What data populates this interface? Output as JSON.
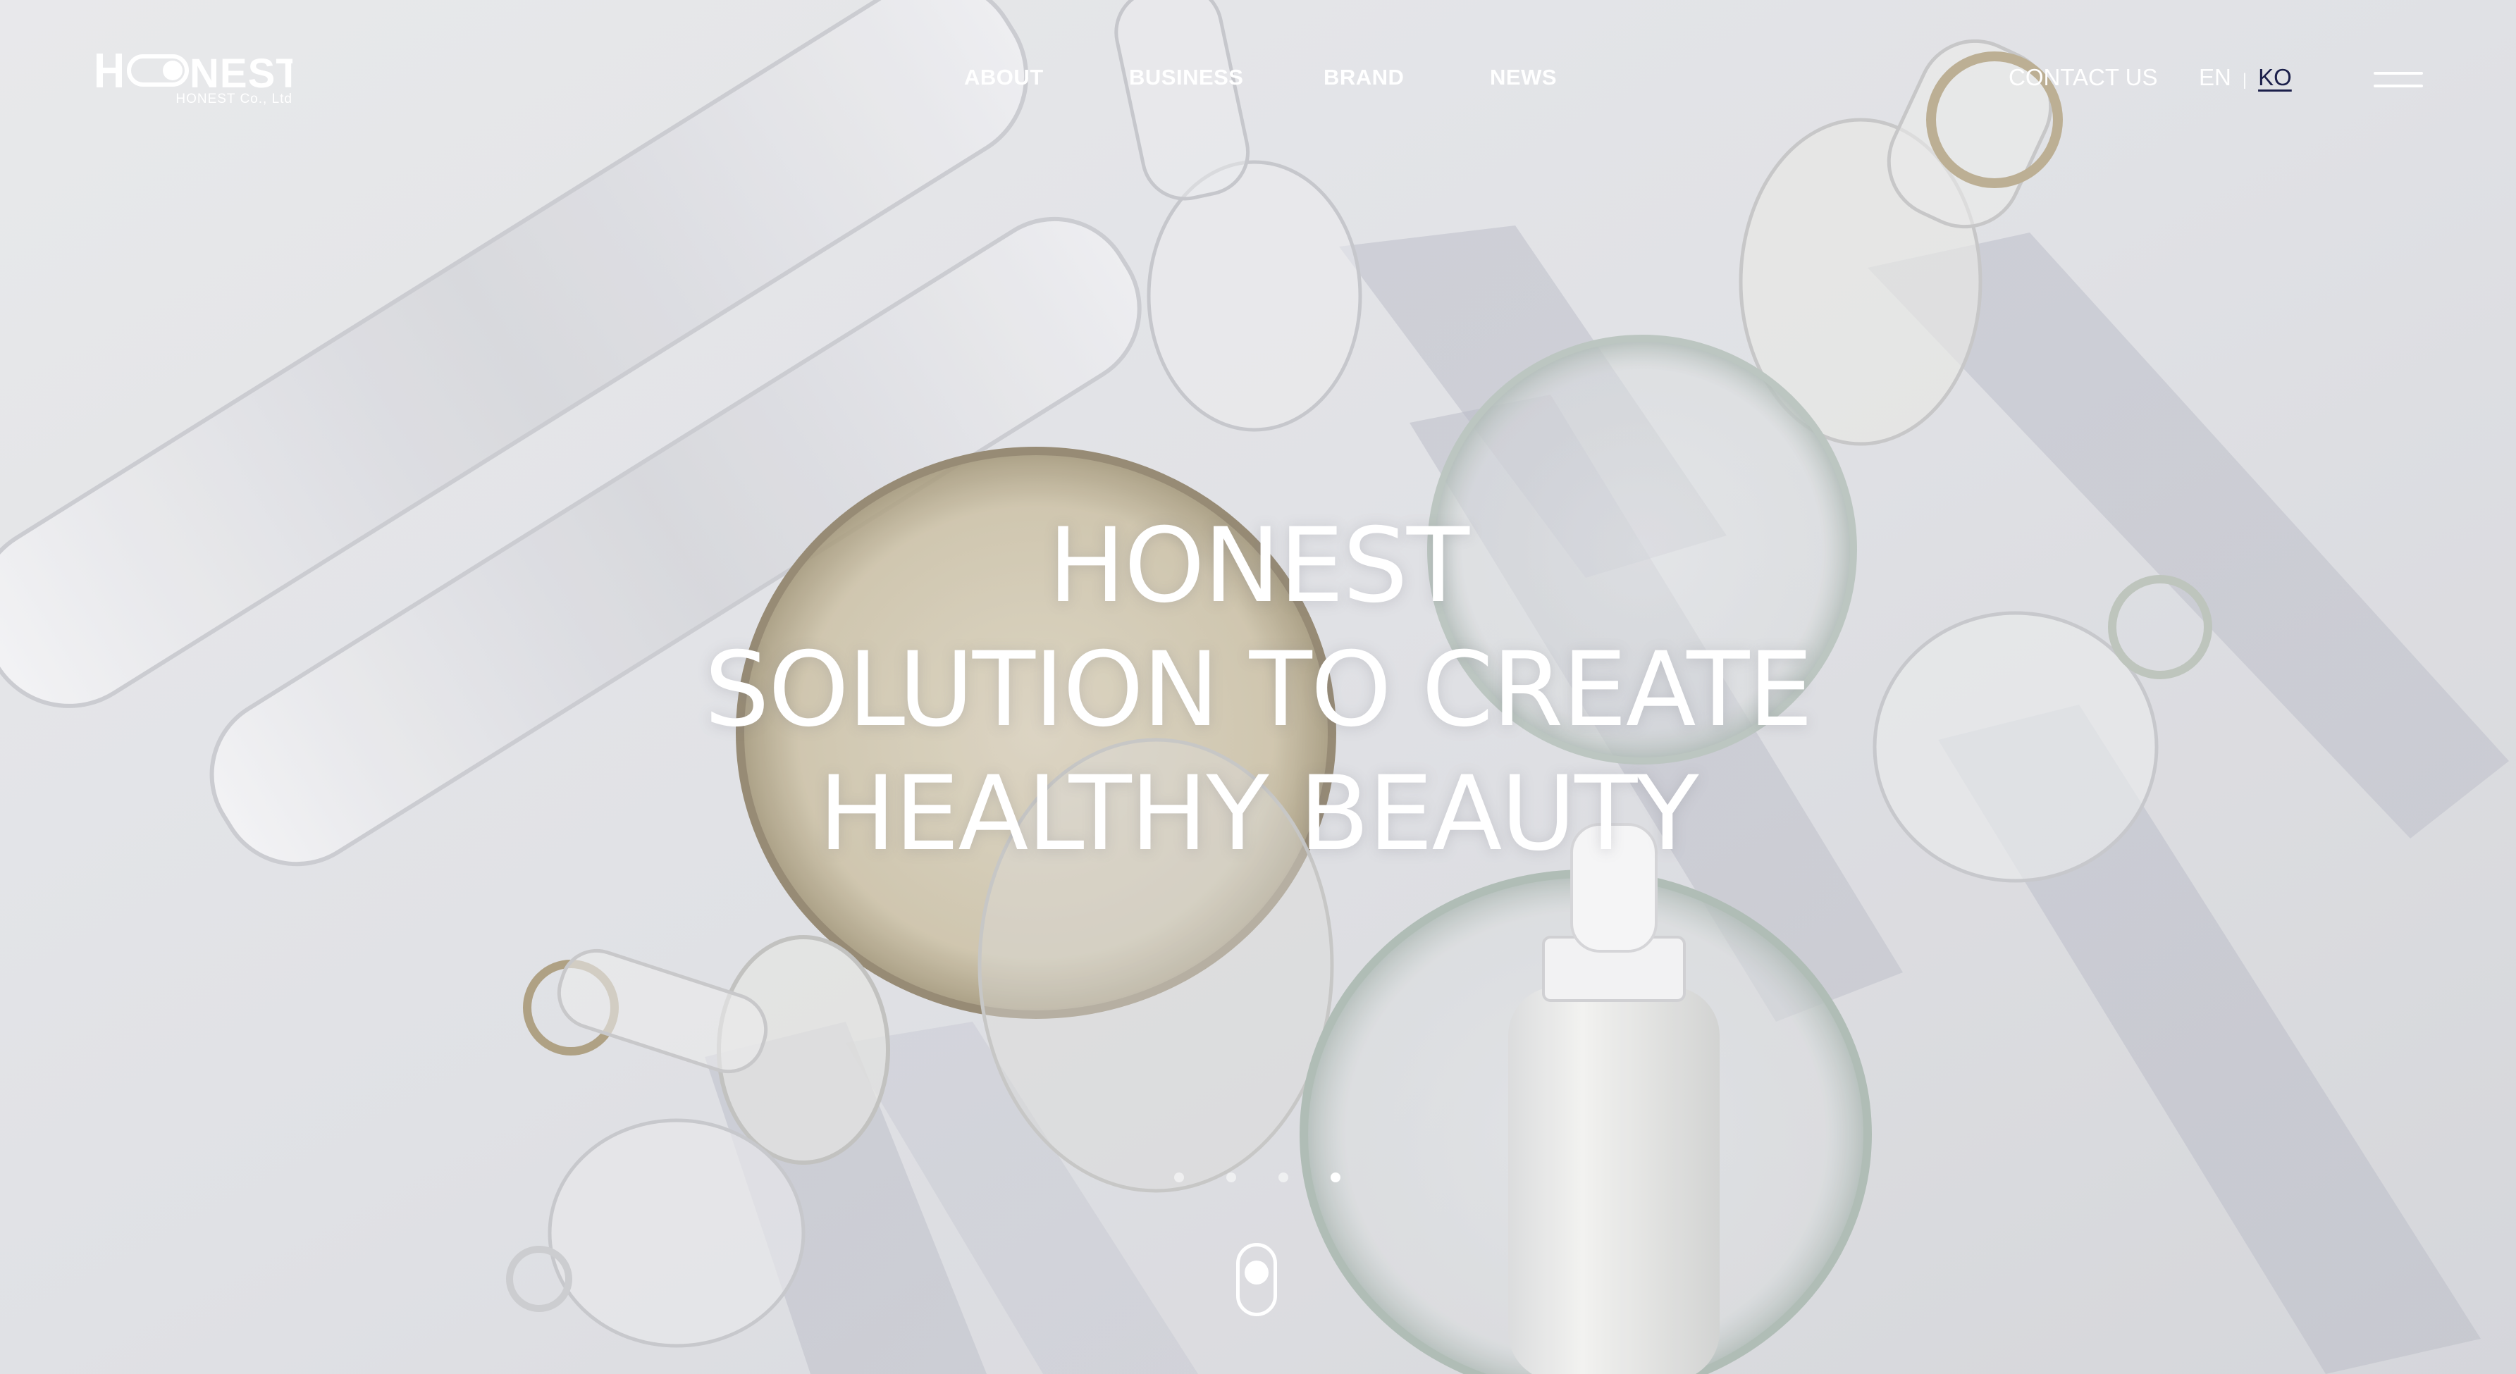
{
  "header": {
    "logo": {
      "wordmark": "HONEST",
      "subtitle": "HONEST Co., Ltd"
    },
    "nav": [
      {
        "label": "ABOUT"
      },
      {
        "label": "BUSINESS"
      },
      {
        "label": "BRAND"
      },
      {
        "label": "NEWS"
      }
    ],
    "contact_label": "CONTACT US",
    "languages": {
      "en": "EN",
      "separator": "|",
      "ko": "KO",
      "active": "KO"
    }
  },
  "hero": {
    "headline_lines": [
      "HONEST",
      "SOLUTION TO CREATE",
      "HEALTHY BEAUTY"
    ],
    "slides_total": 4,
    "active_slide": 4,
    "background_description": "lab glassware with serum bottle"
  },
  "colors": {
    "text_primary": "#ffffff",
    "active_lang": "#1b1f4a",
    "background": "#dcdde2"
  },
  "icons": [
    "hamburger-menu-icon",
    "scroll-mouse-icon"
  ]
}
